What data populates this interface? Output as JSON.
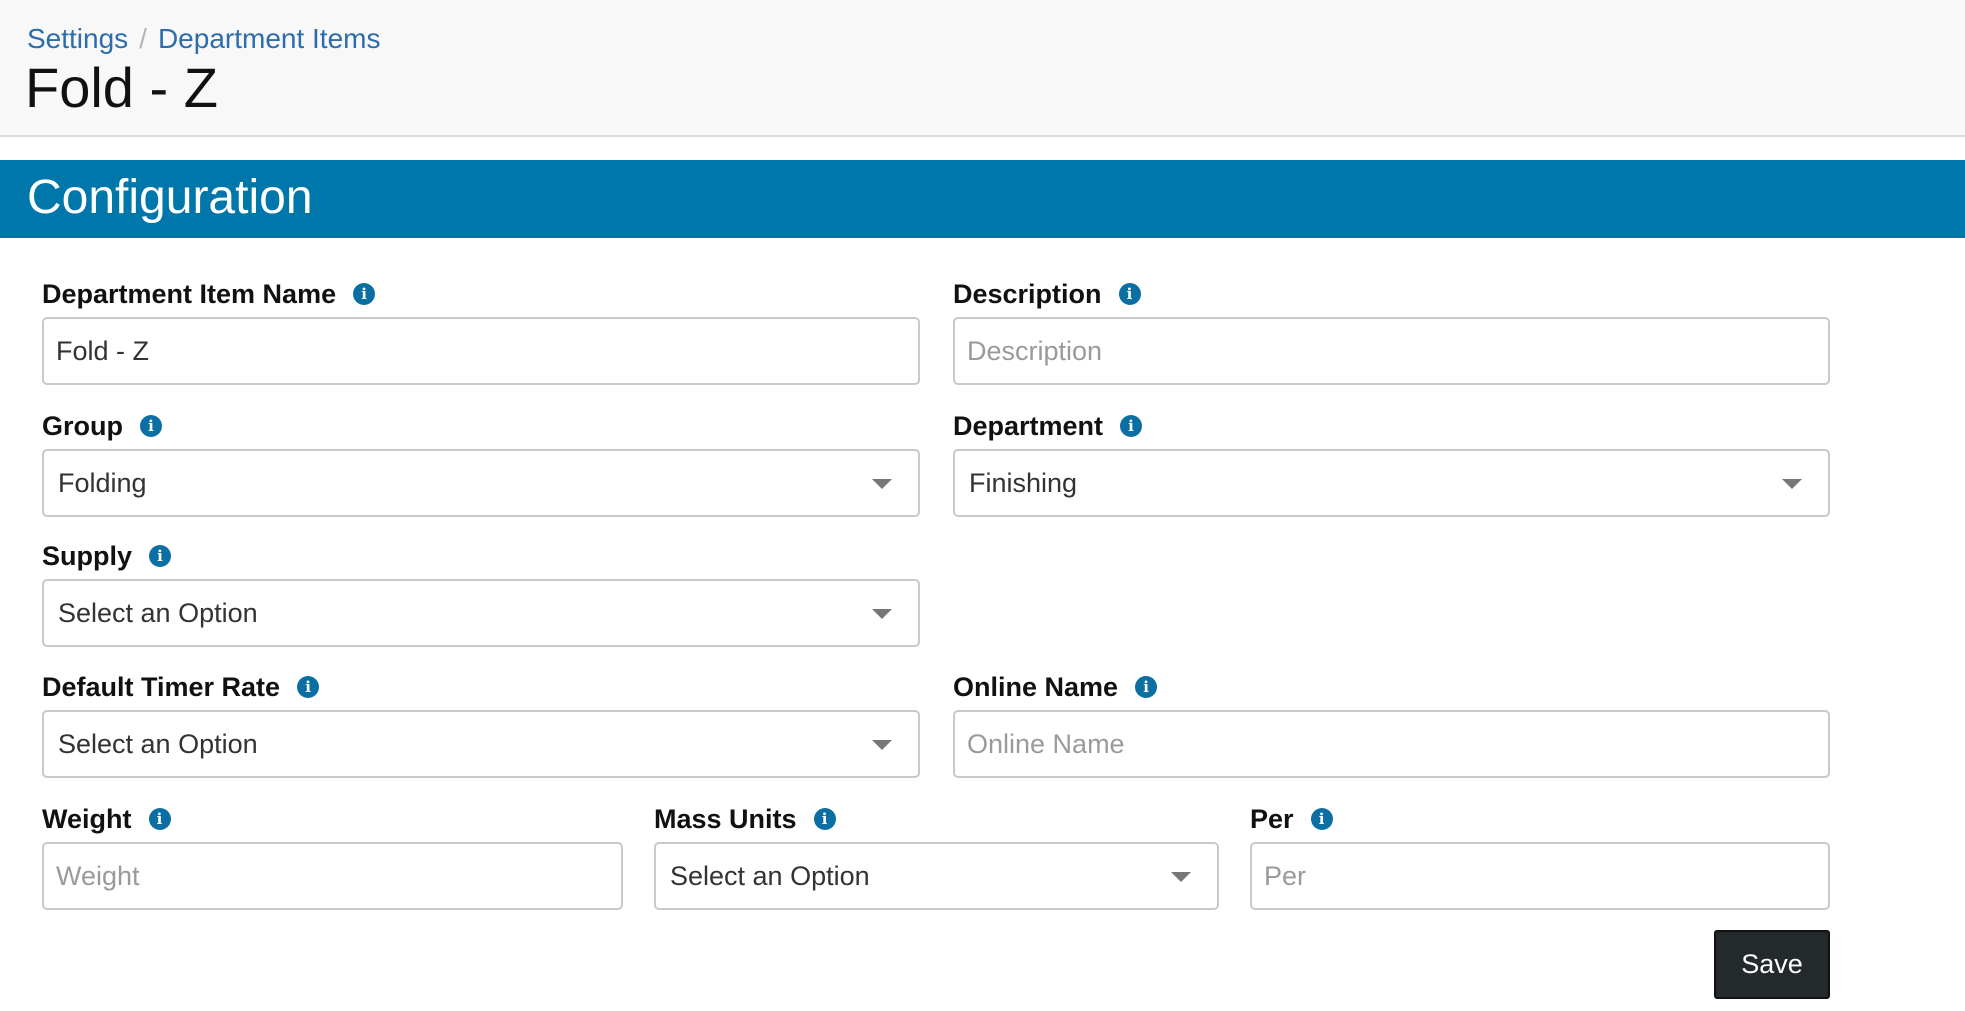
{
  "breadcrumb": {
    "items": [
      "Settings",
      "Department Items"
    ],
    "separator": "/"
  },
  "page": {
    "title": "Fold - Z"
  },
  "section": {
    "title": "Configuration"
  },
  "form": {
    "name": {
      "label": "Department Item Name",
      "value": "Fold - Z",
      "placeholder": ""
    },
    "description": {
      "label": "Description",
      "value": "",
      "placeholder": "Description"
    },
    "group": {
      "label": "Group",
      "selected": "Folding"
    },
    "department": {
      "label": "Department",
      "selected": "Finishing"
    },
    "supply": {
      "label": "Supply",
      "selected": "Select an Option"
    },
    "timer_rate": {
      "label": "Default Timer Rate",
      "selected": "Select an Option"
    },
    "online_name": {
      "label": "Online Name",
      "value": "",
      "placeholder": "Online Name"
    },
    "weight": {
      "label": "Weight",
      "value": "",
      "placeholder": "Weight"
    },
    "mass_units": {
      "label": "Mass Units",
      "selected": "Select an Option"
    },
    "per": {
      "label": "Per",
      "value": "",
      "placeholder": "Per"
    }
  },
  "actions": {
    "save_label": "Save"
  },
  "icons": {
    "info": "info-icon",
    "dropdown": "chevron-down-icon"
  },
  "colors": {
    "banner": "#0077ab",
    "link": "#2d6cad",
    "info": "#0b6fa4",
    "save_button": "#24292b"
  }
}
